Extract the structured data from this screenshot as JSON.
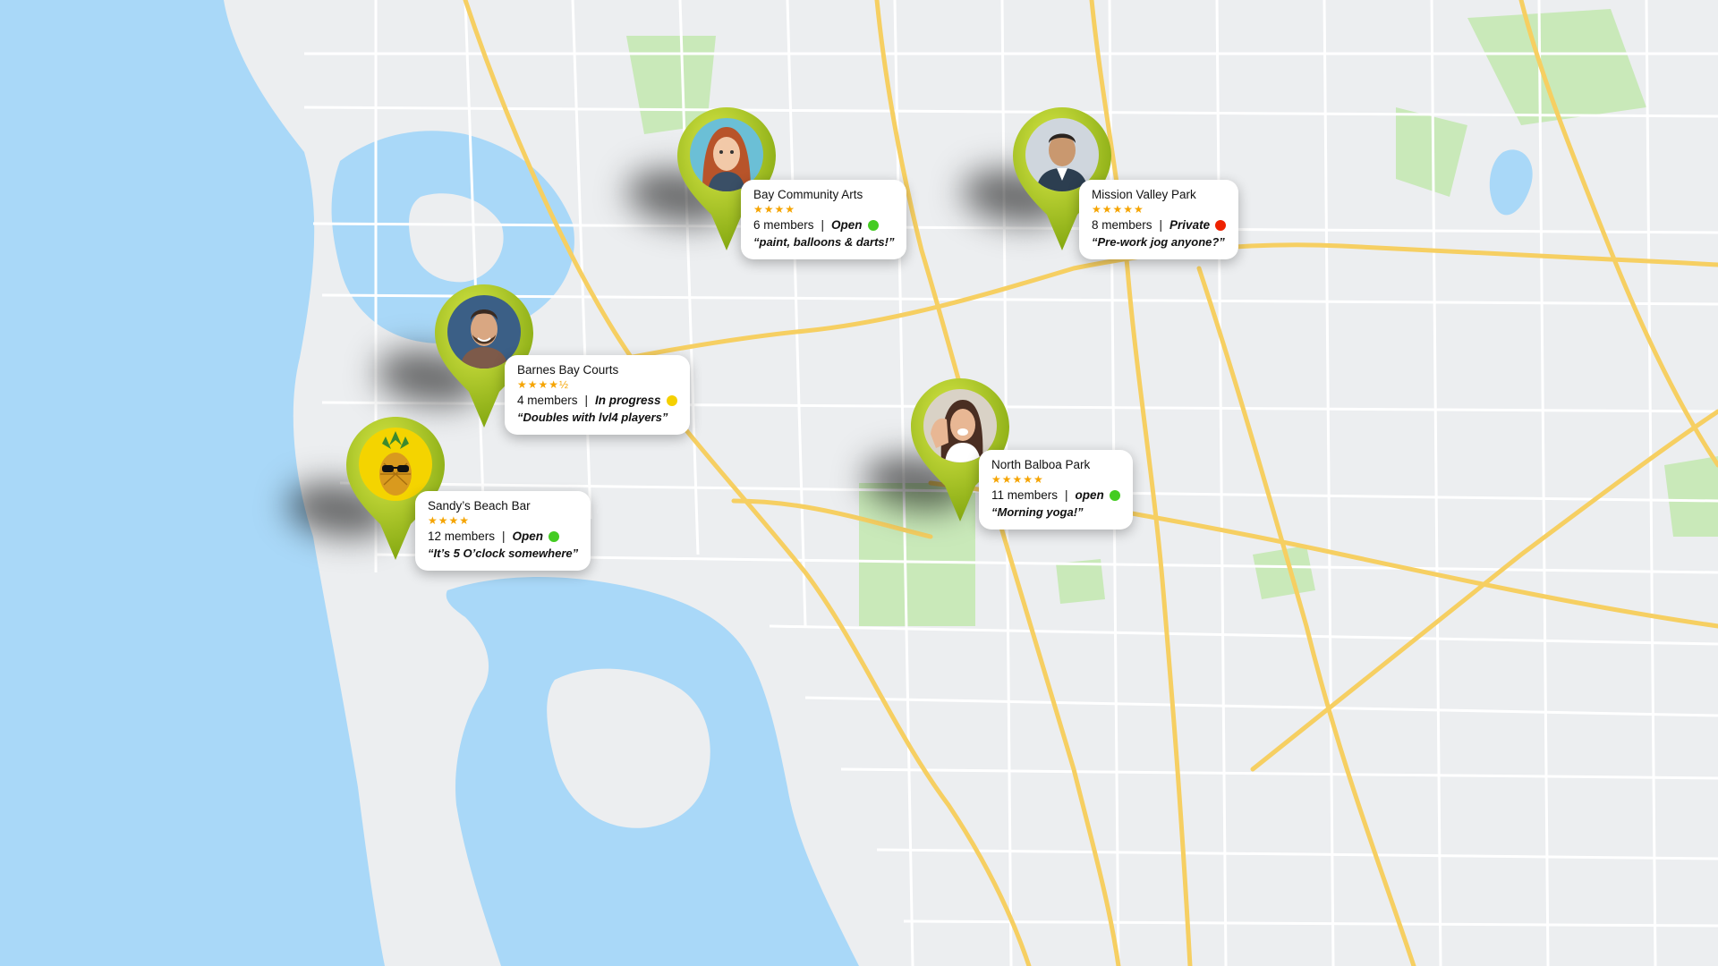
{
  "colors": {
    "water": "#a9d8f8",
    "land": "#eceef0",
    "park": "#c9e9b9",
    "highway": "#f6cf62",
    "road": "#ffffff",
    "pin_light": "#d4e63a",
    "pin_dark": "#7fa40e",
    "star": "#f5a400",
    "status_open": "#44cc22",
    "status_in_progress": "#f5d000",
    "status_private": "#ee2200"
  },
  "markers": [
    {
      "name": "Bay Community Arts",
      "stars": "★★★★",
      "members": "6 members",
      "separator": "|",
      "status": "Open",
      "status_color": "#44cc22",
      "quote": "“paint, balloons & darts!”",
      "avatar": "woman-red-hair"
    },
    {
      "name": "Mission Valley Park",
      "stars": "★★★★★",
      "members": "8 members",
      "separator": "|",
      "status": "Private",
      "status_color": "#ee2200",
      "quote": "“Pre-work jog anyone?”",
      "avatar": "man-suit"
    },
    {
      "name": "Barnes Bay Courts",
      "stars": "★★★★½",
      "members": "4 members",
      "separator": "|",
      "status": "In progress",
      "status_color": "#f5d000",
      "quote": "“Doubles with lvl4 players”",
      "avatar": "man-beard"
    },
    {
      "name": "Sandy’s Beach Bar",
      "stars": "★★★★",
      "members": "12 members",
      "separator": "|",
      "status": "Open",
      "status_color": "#44cc22",
      "quote": "“It’s 5 O’clock somewhere”",
      "avatar": "pineapple-sunglasses"
    },
    {
      "name": "North Balboa Park",
      "stars": "★★★★★",
      "members": "11 members",
      "separator": "|",
      "status": "open",
      "status_color": "#44cc22",
      "quote": "“Morning yoga!”",
      "avatar": "woman-waving"
    }
  ]
}
